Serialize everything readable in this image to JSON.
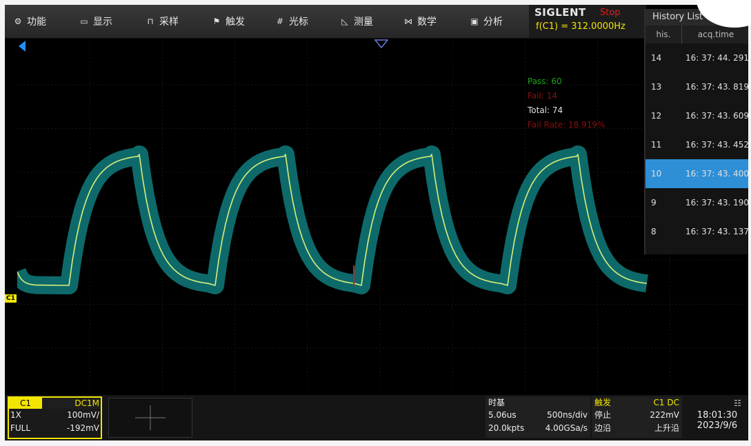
{
  "menu": {
    "items": [
      {
        "label": "功能",
        "icon": "gear-icon"
      },
      {
        "label": "显示",
        "icon": "monitor-icon"
      },
      {
        "label": "采样",
        "icon": "sample-icon"
      },
      {
        "label": "触发",
        "icon": "flag-icon"
      },
      {
        "label": "光标",
        "icon": "cursor-icon"
      },
      {
        "label": "测量",
        "icon": "measure-icon"
      },
      {
        "label": "数学",
        "icon": "math-icon"
      },
      {
        "label": "分析",
        "icon": "analysis-icon"
      }
    ]
  },
  "brand": {
    "logo": "SIGLENT",
    "run_state": "Stop",
    "frequency": "f(C1) = 312.0000Hz"
  },
  "stats": {
    "pass": "Pass: 60",
    "fail": "Fail: 14",
    "total": "Total: 74",
    "fail_rate": "Fail Rate: 18.919%"
  },
  "history": {
    "title": "History List",
    "col_his": "his.",
    "col_time": "acq.time",
    "rows": [
      {
        "n": "14",
        "t": "16: 37: 44. 291"
      },
      {
        "n": "13",
        "t": "16: 37: 43. 819"
      },
      {
        "n": "12",
        "t": "16: 37: 43. 609"
      },
      {
        "n": "11",
        "t": "16: 37: 43. 452"
      },
      {
        "n": "10",
        "t": "16: 37: 43. 400",
        "selected": true
      },
      {
        "n": "9",
        "t": "16: 37: 43. 190"
      },
      {
        "n": "8",
        "t": "16: 37: 43. 137"
      }
    ]
  },
  "channel": {
    "label": "C1",
    "coupling": "DC1M",
    "probe": "1X",
    "scale": "100mV/",
    "bandwidth": "FULL",
    "offset": "-192mV",
    "marker": "C1"
  },
  "timebase": {
    "title": "时基",
    "delay": "5.06us",
    "scale": "500ns/div",
    "memory": "20.0kpts",
    "sample_rate": "4.00GSa/s"
  },
  "trigger": {
    "title": "触发",
    "source": "C1 DC",
    "state": "停止",
    "level": "222mV",
    "type": "边沿",
    "slope": "上升沿"
  },
  "clock": {
    "time": "18:01:30",
    "date": "2023/9/6"
  },
  "colors": {
    "trace": "#d8f07a",
    "mask": "#0e6a6a",
    "channel": "#f2e600",
    "selected": "#2f8fd6"
  },
  "waveform": {
    "cycles": 4,
    "state": "stopped"
  }
}
